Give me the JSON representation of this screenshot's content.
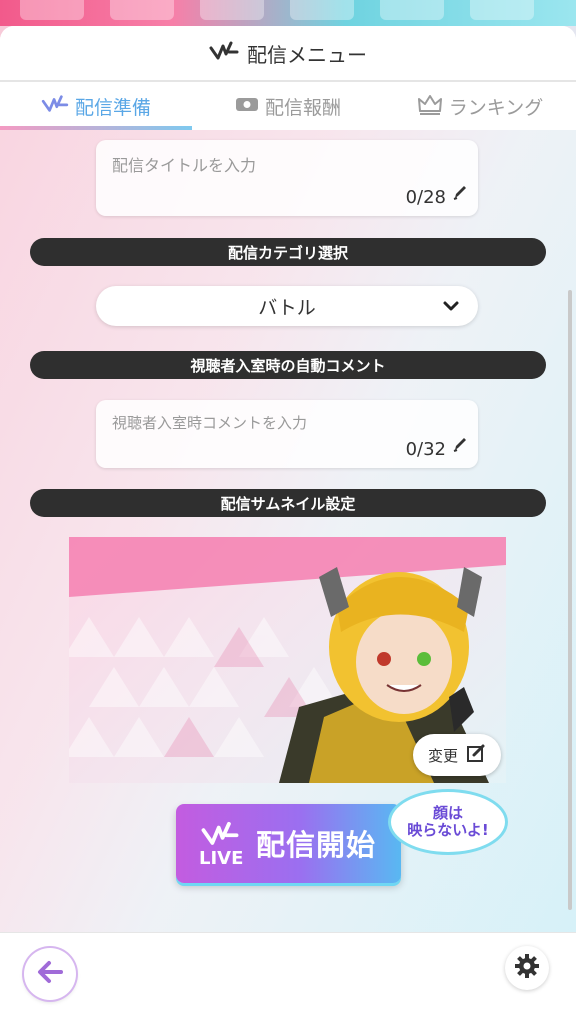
{
  "header": {
    "title": "配信メニュー"
  },
  "tabs": [
    {
      "label": "配信準備",
      "icon": "live-logo-icon",
      "active": true
    },
    {
      "label": "配信報酬",
      "icon": "reward-box-icon",
      "active": false
    },
    {
      "label": "ランキング",
      "icon": "crown-icon",
      "active": false
    }
  ],
  "title_input": {
    "placeholder": "配信タイトルを入力",
    "count": "0/28"
  },
  "category": {
    "section_label": "配信カテゴリ選択",
    "selected": "バトル"
  },
  "auto_comment": {
    "section_label": "視聴者入室時の自動コメント",
    "placeholder": "視聴者入室時コメントを入力",
    "count": "0/32"
  },
  "thumbnail": {
    "section_label": "配信サムネイル設定",
    "change_label": "変更"
  },
  "live_button": {
    "label": "配信開始",
    "live_text": "LIVE"
  },
  "bubble": {
    "line1": "顔は",
    "line2": "映らないよ!"
  },
  "colors": {
    "accent_blue": "#5aa7e6",
    "section_bar": "#2f2f2f",
    "live_gradient_start": "#c35ce0",
    "live_gradient_end": "#59b8f2"
  }
}
